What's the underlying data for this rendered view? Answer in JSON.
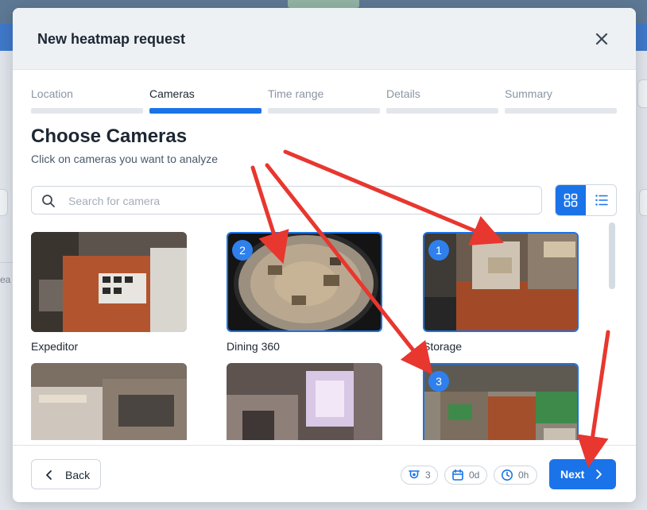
{
  "modal": {
    "title": "New heatmap request"
  },
  "steps": [
    {
      "label": "Location",
      "active": false
    },
    {
      "label": "Cameras",
      "active": true
    },
    {
      "label": "Time range",
      "active": false
    },
    {
      "label": "Details",
      "active": false
    },
    {
      "label": "Summary",
      "active": false
    }
  ],
  "section": {
    "title": "Choose Cameras",
    "subtitle": "Click on cameras you want to analyze"
  },
  "search": {
    "placeholder": "Search for camera",
    "value": ""
  },
  "view": {
    "selected": "grid"
  },
  "cameras": [
    {
      "name": "Expeditor",
      "selected": false,
      "order": ""
    },
    {
      "name": "Dining 360",
      "selected": true,
      "order": "2"
    },
    {
      "name": "Storage",
      "selected": true,
      "order": "1"
    },
    {
      "name": "",
      "selected": false,
      "order": ""
    },
    {
      "name": "",
      "selected": false,
      "order": ""
    },
    {
      "name": "",
      "selected": true,
      "order": "3"
    }
  ],
  "footer": {
    "back_label": "Back",
    "next_label": "Next",
    "camera_count": "3",
    "days": "0d",
    "hours": "0h"
  },
  "background": {
    "left_partial_text": "ea"
  },
  "colors": {
    "accent": "#1a73e8",
    "badge": "#2f80ed",
    "annotation_arrow": "#e8372f"
  }
}
